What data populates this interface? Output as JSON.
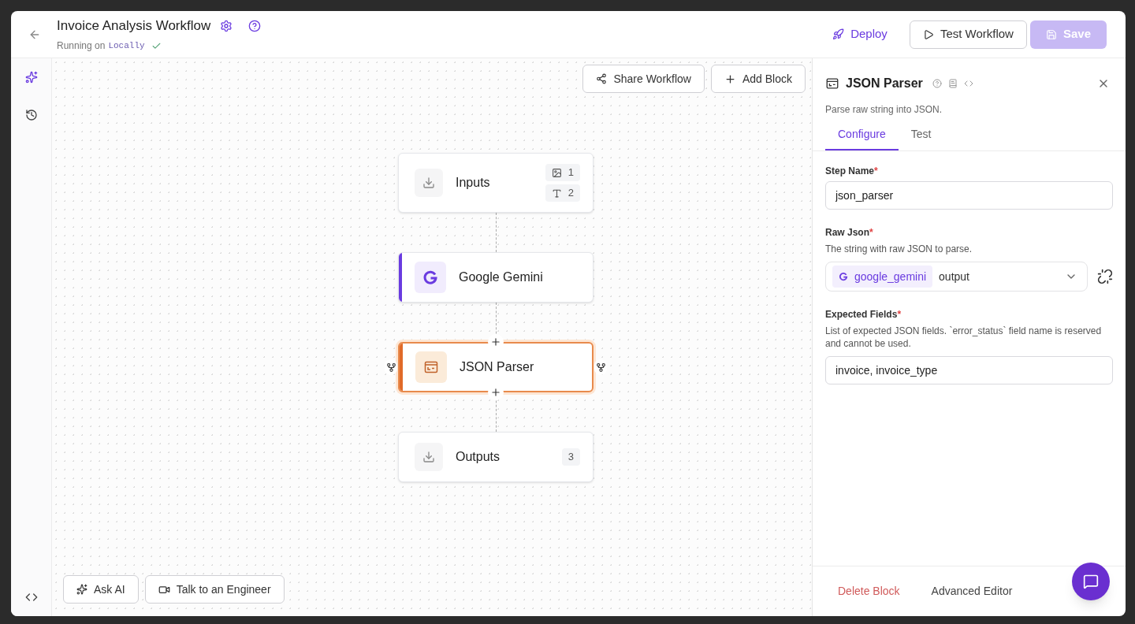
{
  "header": {
    "title": "Invoice Analysis Workflow",
    "running_label": "Running on",
    "running_target": "Locally",
    "verified": true
  },
  "actions": {
    "deploy": "Deploy",
    "test": "Test Workflow",
    "save": {
      "label": "Save",
      "disabled": true
    }
  },
  "toolbar": {
    "share": "Share Workflow",
    "add": "Add Block"
  },
  "nodes": [
    {
      "kind": "input",
      "label": "Inputs",
      "selected": false,
      "badges": [
        {
          "kind": "image",
          "count": "1"
        },
        {
          "kind": "text",
          "count": "2"
        }
      ]
    },
    {
      "kind": "llm",
      "label": "Google Gemini",
      "selected": false,
      "color": "#6a3be0"
    },
    {
      "kind": "parser",
      "label": "JSON Parser",
      "selected": true,
      "color": "#e06a28"
    },
    {
      "kind": "output",
      "label": "Outputs",
      "selected": false,
      "badges": [
        {
          "kind": "count",
          "count": "3"
        }
      ]
    }
  ],
  "bottom_buttons": [
    {
      "kind": "ai",
      "label": "Ask AI"
    },
    {
      "kind": "video",
      "label": "Talk to an Engineer"
    }
  ],
  "panel": {
    "title": "JSON Parser",
    "description": "Parse raw string into JSON.",
    "tabs": [
      {
        "label": "Configure",
        "selected": true
      },
      {
        "label": "Test",
        "selected": false
      }
    ],
    "fields": [
      {
        "kind": "text",
        "label": "Step Name",
        "required": true,
        "value": "json_parser"
      },
      {
        "kind": "reference",
        "label": "Raw Json",
        "required": true,
        "hint": "The string with raw JSON to parse.",
        "source": "google_gemini",
        "value": "output"
      },
      {
        "kind": "text",
        "label": "Expected Fields",
        "required": true,
        "hint": "List of expected JSON fields. `error_status` field name is reserved and cannot be used.",
        "value": "invoice, invoice_type"
      }
    ],
    "required_mark": "*",
    "footer": {
      "delete": "Delete Block",
      "advanced": "Advanced Editor"
    }
  }
}
